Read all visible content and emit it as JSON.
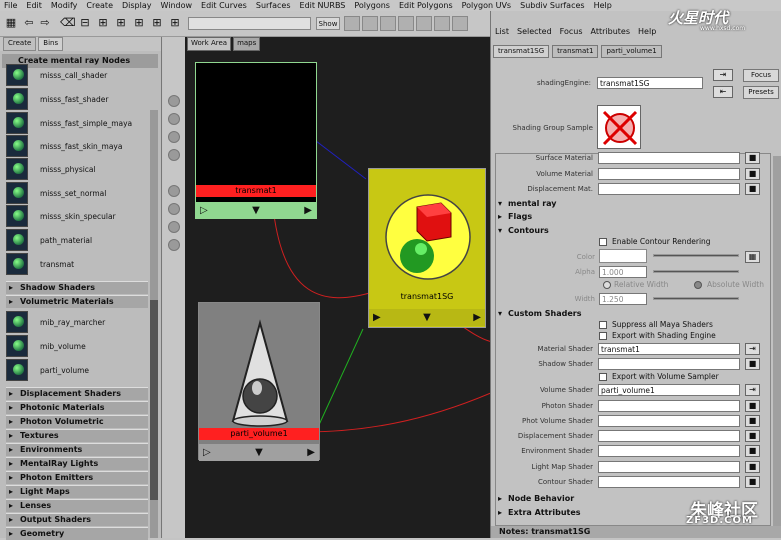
{
  "menubar": [
    "File",
    "Edit",
    "Modify",
    "Create",
    "Display",
    "Window",
    "Edit Curves",
    "Surfaces",
    "Edit NURBS",
    "Polygons",
    "Edit Polygons",
    "Polygon UVs",
    "Subdiv Surfaces",
    "Help"
  ],
  "toolbar": {
    "show_label": "Show"
  },
  "left": {
    "tabs": [
      "Create",
      "Bins"
    ],
    "header": "Create mental ray Nodes",
    "shaders": [
      "misss_call_shader",
      "misss_fast_shader",
      "misss_fast_simple_maya",
      "misss_fast_skin_maya",
      "misss_physical",
      "misss_set_normal",
      "misss_skin_specular",
      "path_material",
      "transmat"
    ],
    "cat_shadow": "Shadow Shaders",
    "cat_volumetric": "Volumetric Materials",
    "volumetric": [
      "mib_ray_marcher",
      "mib_volume",
      "parti_volume"
    ],
    "cats": [
      "Displacement Shaders",
      "Photonic Materials",
      "Photon Volumetric Materials",
      "Textures",
      "Environments",
      "MentalRay Lights",
      "Photon Emitters",
      "Light Maps",
      "Lenses",
      "Output Shaders",
      "Geometry"
    ]
  },
  "hypershade": {
    "tabs": [
      "Work Area",
      "maps"
    ],
    "nodes": {
      "transmat": "transmat1",
      "sg": "transmat1SG",
      "parti": "parti_volume1"
    }
  },
  "attr": {
    "menu": [
      "List",
      "Selected",
      "Focus",
      "Attributes",
      "Help"
    ],
    "tabs": [
      "transmat1SG",
      "transmat1",
      "parti_volume1"
    ],
    "shading_engine_label": "shadingEngine:",
    "shading_engine_value": "transmat1SG",
    "focus": "Focus",
    "presets": "Presets",
    "sample_label": "Shading Group Sample",
    "surface_material": "Surface Material",
    "volume_material": "Volume Material",
    "displacement_mat": "Displacement Mat.",
    "sec_mentalray": "mental ray",
    "sec_flags": "Flags",
    "sec_contours": "Contours",
    "enable_contour": "Enable Contour Rendering",
    "color": "Color",
    "alpha": "Alpha",
    "alpha_value": "1.000",
    "relative_width": "Relative Width",
    "absolute_width": "Absolute Width",
    "width": "Width",
    "width_value": "1.250",
    "sec_custom": "Custom Shaders",
    "suppress": "Suppress all Maya Shaders",
    "export_shading": "Export with Shading Engine",
    "material_shader": "Material Shader",
    "material_shader_value": "transmat1",
    "shadow_shader": "Shadow Shader",
    "export_volume": "Export with Volume Sampler",
    "volume_shader": "Volume Shader",
    "volume_shader_value": "parti_volume1",
    "photon_shader": "Photon Shader",
    "photon_volume_shader": "Phot Volume Shader",
    "displacement_shader": "Displacement Shader",
    "environment_shader": "Environment Shader",
    "lightmap_shader": "Light Map Shader",
    "contour_shader": "Contour Shader",
    "sec_node_behavior": "Node Behavior",
    "sec_extra": "Extra Attributes",
    "notes": "Notes: transmat1SG"
  },
  "watermark": {
    "top": "火星时代",
    "top_url": "www.hxsd.com",
    "bottom": "朱峰社区",
    "bottom_url": "ZF3D.COM"
  },
  "colors": {
    "node_red": "#ff2020",
    "node_green": "#90d890",
    "node_yellow": "#c8c814",
    "connection_red": "#d02020"
  }
}
